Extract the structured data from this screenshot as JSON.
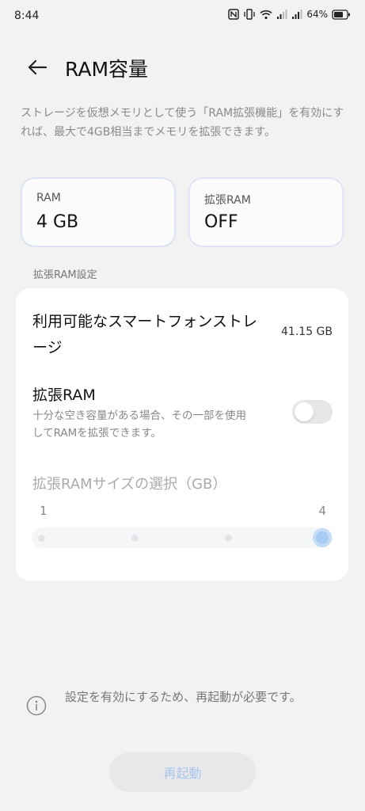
{
  "status_bar": {
    "time": "8:44",
    "battery": "64%",
    "icons": [
      "nfc-icon",
      "vibrate-icon",
      "wifi-icon",
      "signal-icon",
      "signal-icon",
      "battery-icon"
    ]
  },
  "header": {
    "title": "RAM容量",
    "back_icon": "arrow-left-icon"
  },
  "description": "ストレージを仮想メモリとして使う「RAM拡張機能」を有効にすれば、最大で4GB相当までメモリを拡張できます。",
  "cards": {
    "ram": {
      "label": "RAM",
      "value": "4 GB"
    },
    "extended_ram": {
      "label": "拡張RAM",
      "value": "OFF"
    }
  },
  "section_label": "拡張RAM設定",
  "panel": {
    "storage_label": "利用可能なスマートフォンストレージ",
    "storage_value": "41.15 GB",
    "extended_ram_title": "拡張RAM",
    "extended_ram_desc": "十分な空き容量がある場合、その一部を使用してRAMを拡張できます。",
    "extended_ram_enabled": false,
    "size_title": "拡張RAMサイズの選択（GB）",
    "slider": {
      "min_label": "1",
      "max_label": "4",
      "min": 1,
      "max": 4,
      "value": 4,
      "steps": 4
    }
  },
  "notice": "設定を有効にするため、再起動が必要です。",
  "restart_button": "再起動",
  "colors": {
    "background": "#f2f2f3",
    "accent": "#a8cbf5",
    "panel": "#ffffff"
  }
}
